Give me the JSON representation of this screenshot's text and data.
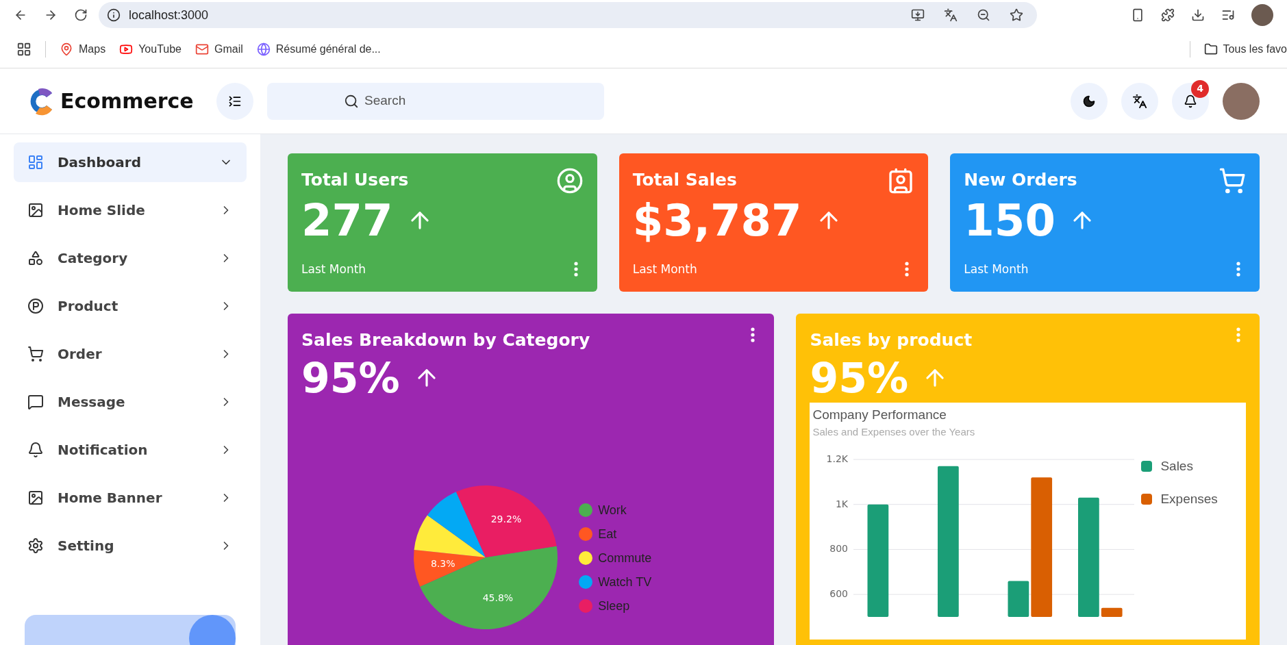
{
  "browser": {
    "url": "localhost:3000",
    "bookmarks": [
      {
        "label": "Maps",
        "kind": "maps"
      },
      {
        "label": "YouTube",
        "kind": "youtube"
      },
      {
        "label": "Gmail",
        "kind": "gmail"
      },
      {
        "label": "Résumé général de...",
        "kind": "site"
      }
    ],
    "all_bookmarks": "Tous les favo"
  },
  "header": {
    "brand": "Ecommerce",
    "search": {
      "placeholder": "Search"
    },
    "notification_count": "4"
  },
  "sidebar": {
    "items": [
      {
        "label": "Dashboard",
        "kind": "dashboard",
        "selected": true
      },
      {
        "label": "Home Slide",
        "kind": "image",
        "selected": false
      },
      {
        "label": "Category",
        "kind": "category",
        "selected": false
      },
      {
        "label": "Product",
        "kind": "product",
        "selected": false
      },
      {
        "label": "Order",
        "kind": "order",
        "selected": false
      },
      {
        "label": "Message",
        "kind": "message",
        "selected": false
      },
      {
        "label": "Notification",
        "kind": "notification",
        "selected": false
      },
      {
        "label": "Home Banner",
        "kind": "image",
        "selected": false
      },
      {
        "label": "Setting",
        "kind": "setting",
        "selected": false
      }
    ]
  },
  "stats": [
    {
      "title": "Total Users",
      "value": "277",
      "caption": "Last Month",
      "kind": "users",
      "color": "#4caf50"
    },
    {
      "title": "Total Sales",
      "value": "$3,787",
      "caption": "Last Month",
      "kind": "sales",
      "color": "#ff5722"
    },
    {
      "title": "New Orders",
      "value": "150",
      "caption": "Last Month",
      "kind": "orders",
      "color": "#2196f3"
    }
  ],
  "panels": [
    {
      "title": "Sales Breakdown by Category",
      "value": "95%",
      "color": "#9c27b0",
      "chart_data": {
        "type": "pie",
        "categories": [
          "Work",
          "Eat",
          "Commute",
          "Watch TV",
          "Sleep"
        ],
        "legend": "right",
        "series": [
          {
            "colors": [
              "#4caf50",
              "#ff5722",
              "#ffeb3b",
              "#03a9f4",
              "#e91e63"
            ],
            "values": [
              45.8,
              8.3,
              8.3,
              8.3,
              29.2
            ]
          }
        ],
        "value_labels": [
          "45.8%",
          "8.3%",
          null,
          null,
          "29.2%"
        ]
      }
    },
    {
      "title": "Sales by product",
      "value": "95%",
      "color": "#ffc107",
      "chart_subtitle": "Sales and Expenses over the Years",
      "chart_data": {
        "type": "bar",
        "title": "Company Performance",
        "ylim": [
          500,
          1200
        ],
        "grid": true,
        "legend": "right",
        "yticks": [
          {
            "value": 600,
            "label": "600"
          },
          {
            "value": 800,
            "label": "800"
          },
          {
            "value": 1000,
            "label": "1K"
          },
          {
            "value": 1200,
            "label": "1.2K"
          }
        ],
        "series": [
          {
            "name": "Sales",
            "color": "#1b9e77",
            "values": [
              1000,
              1170,
              660,
              1030
            ]
          },
          {
            "name": "Expenses",
            "color": "#d95f02",
            "values": [
              null,
              null,
              1120,
              540
            ]
          }
        ]
      }
    }
  ]
}
